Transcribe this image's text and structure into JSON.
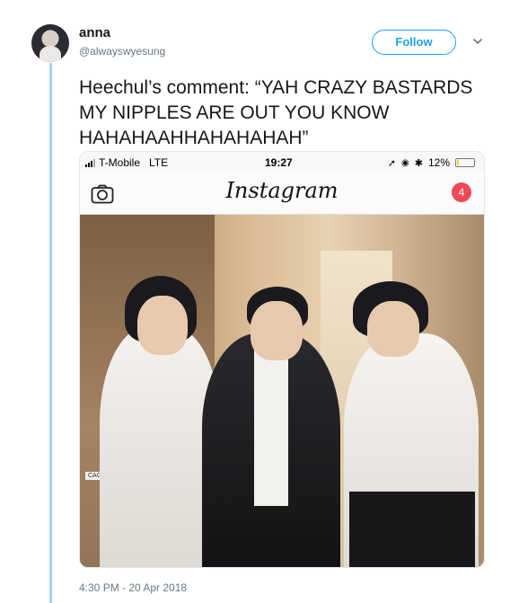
{
  "user": {
    "name": "anna",
    "handle": "@alwayswyesung"
  },
  "follow_label": "Follow",
  "tweet_text": "Heechul’s comment: “YAH CRAZY BASTARDS MY NIPPLES ARE OUT YOU KNOW HAHAHAAHHAHAHAHAH”",
  "media": {
    "status_bar": {
      "carrier": "T-Mobile",
      "network": "LTE",
      "time": "19:27",
      "battery": "12%",
      "battery_fraction": 0.12
    },
    "instagram": {
      "logo": "Instagram",
      "notification_count": "4",
      "icons": [
        "camera-icon"
      ]
    },
    "photo_sign_text": "CAGO"
  },
  "timestamp": "4:30 PM - 20 Apr 2018",
  "colors": {
    "accent": "#1da1f2",
    "thread_line": "#a6d3f5",
    "badge": "#ed4956",
    "secondary_text": "#657786"
  }
}
